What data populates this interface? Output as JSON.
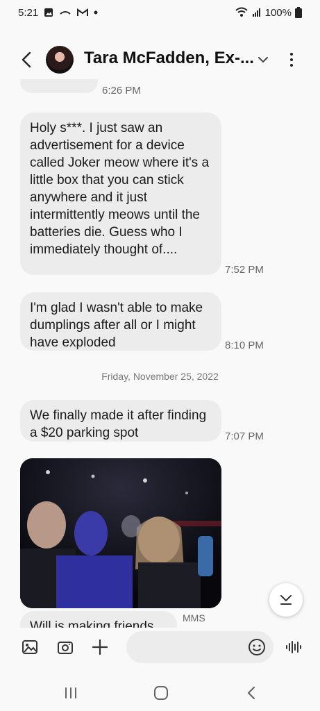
{
  "status": {
    "time": "5:21",
    "battery": "100%",
    "left_icons": [
      "gallery-icon",
      "voicemail-icon",
      "gmail-icon",
      "dot-icon"
    ],
    "right_icons": [
      "wifi-icon",
      "signal-icon",
      "battery-icon"
    ]
  },
  "header": {
    "contact_name": "Tara McFadden, Ex-..."
  },
  "messages": [
    {
      "text": "",
      "time": "6:26 PM"
    },
    {
      "text": "Holy s***. I just saw an advertisement for a device called Joker meow where it's a little box that you can stick anywhere and it just intermittently meows until the batteries die. Guess who I immediately thought of....",
      "time": "7:52 PM"
    },
    {
      "text": "I'm glad I wasn't able to make dumplings after all or I might have exploded",
      "time": "8:10 PM"
    },
    {
      "text": "We finally made it after finding a $20 parking spot",
      "time": "7:07 PM"
    },
    {
      "text": "Will is making friends",
      "time": ""
    }
  ],
  "date_separator": "Friday, November 25, 2022",
  "mms_label": "MMS",
  "composer": {
    "placeholder": "",
    "icons": [
      "gallery-icon",
      "camera-icon",
      "plus-icon",
      "emoji-icon",
      "voice-icon"
    ]
  },
  "navbar": {
    "icons": [
      "recents-icon",
      "home-icon",
      "back-icon"
    ]
  }
}
